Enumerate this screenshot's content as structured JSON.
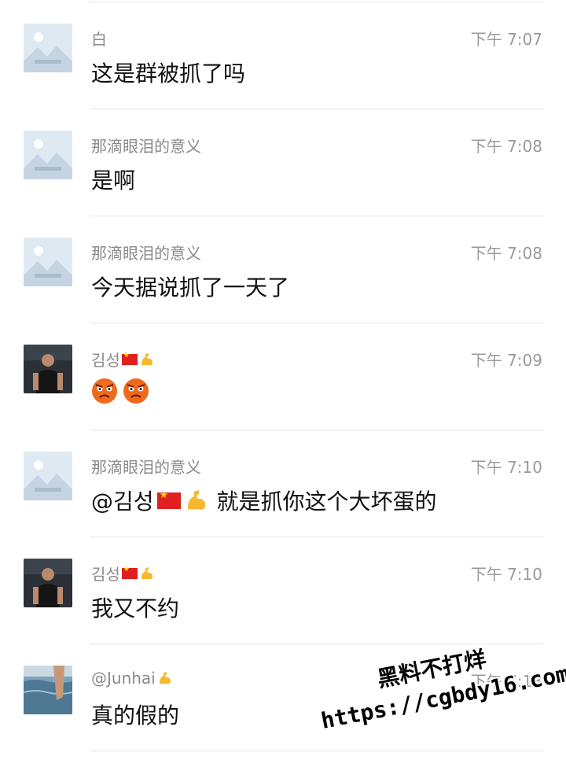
{
  "messages": [
    {
      "sender": "白",
      "time": "下午 7:07",
      "text": "这是群被抓了吗",
      "avatar": "placeholder"
    },
    {
      "sender": "那滴眼泪的意义",
      "time": "下午 7:08",
      "text": "是啊",
      "avatar": "placeholder"
    },
    {
      "sender": "那滴眼泪的意义",
      "time": "下午 7:08",
      "text": "今天据说抓了一天了",
      "avatar": "placeholder"
    },
    {
      "sender": "김성",
      "time": "下午 7:09",
      "text": "",
      "avatar": "man"
    },
    {
      "sender": "那滴眼泪的意义",
      "time": "下午 7:10",
      "mention": "@김성",
      "text": "就是抓你这个大坏蛋的",
      "avatar": "placeholder"
    },
    {
      "sender": "김성",
      "time": "下午 7:10",
      "text": "我又不约",
      "avatar": "man"
    },
    {
      "sender": "@Junhai",
      "time": "下午 7:13",
      "text": "真的假的",
      "avatar": "sea"
    }
  ],
  "watermark": {
    "line1": "黑料不打烊",
    "line2": "https://cgbdy16.com"
  },
  "colors": {
    "name": "#8a8a8a",
    "time": "#9a9a9a",
    "text": "#111111",
    "divider": "#e6e6e6"
  }
}
